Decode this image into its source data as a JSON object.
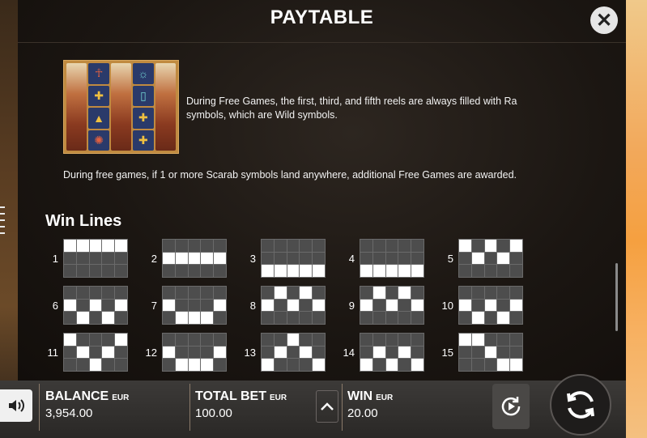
{
  "title": "PAYTABLE",
  "close_icon": "close-icon",
  "free_games_text_1": "During Free Games, the first, third, and fifth reels are always filled with Ra symbols, which are Wild symbols.",
  "free_games_text_2": "During free games, if 1 or more Scarab symbols land anywhere, additional Free Games are awarded.",
  "win_lines_title": "Win Lines",
  "win_lines": [
    {
      "number": "1",
      "pattern": [
        [
          1,
          1,
          1,
          1,
          1
        ],
        [
          0,
          0,
          0,
          0,
          0
        ],
        [
          0,
          0,
          0,
          0,
          0
        ]
      ]
    },
    {
      "number": "2",
      "pattern": [
        [
          0,
          0,
          0,
          0,
          0
        ],
        [
          1,
          1,
          1,
          1,
          1
        ],
        [
          0,
          0,
          0,
          0,
          0
        ]
      ]
    },
    {
      "number": "3",
      "pattern": [
        [
          0,
          0,
          0,
          0,
          0
        ],
        [
          0,
          0,
          0,
          0,
          0
        ],
        [
          1,
          1,
          1,
          1,
          1
        ]
      ]
    },
    {
      "number": "4",
      "pattern": [
        [
          0,
          0,
          0,
          0,
          0
        ],
        [
          0,
          0,
          0,
          0,
          0
        ],
        [
          1,
          1,
          1,
          1,
          1
        ]
      ]
    },
    {
      "number": "5",
      "pattern": [
        [
          1,
          0,
          1,
          0,
          1
        ],
        [
          0,
          1,
          0,
          1,
          0
        ],
        [
          0,
          0,
          0,
          0,
          0
        ]
      ]
    },
    {
      "number": "6",
      "pattern": [
        [
          0,
          0,
          0,
          0,
          0
        ],
        [
          1,
          0,
          1,
          0,
          1
        ],
        [
          0,
          1,
          0,
          1,
          0
        ]
      ]
    },
    {
      "number": "7",
      "pattern": [
        [
          0,
          0,
          0,
          0,
          0
        ],
        [
          1,
          0,
          0,
          0,
          1
        ],
        [
          0,
          1,
          1,
          1,
          0
        ]
      ]
    },
    {
      "number": "8",
      "pattern": [
        [
          0,
          1,
          0,
          1,
          0
        ],
        [
          1,
          0,
          1,
          0,
          1
        ],
        [
          0,
          0,
          0,
          0,
          0
        ]
      ]
    },
    {
      "number": "9",
      "pattern": [
        [
          0,
          1,
          0,
          1,
          0
        ],
        [
          1,
          0,
          1,
          0,
          1
        ],
        [
          0,
          0,
          0,
          0,
          0
        ]
      ]
    },
    {
      "number": "10",
      "pattern": [
        [
          0,
          0,
          0,
          0,
          0
        ],
        [
          1,
          0,
          1,
          0,
          1
        ],
        [
          0,
          1,
          0,
          1,
          0
        ]
      ]
    },
    {
      "number": "11",
      "pattern": [
        [
          1,
          0,
          0,
          0,
          1
        ],
        [
          0,
          1,
          0,
          1,
          0
        ],
        [
          0,
          0,
          1,
          0,
          0
        ]
      ]
    },
    {
      "number": "12",
      "pattern": [
        [
          0,
          0,
          0,
          0,
          0
        ],
        [
          1,
          0,
          0,
          0,
          1
        ],
        [
          0,
          1,
          1,
          1,
          0
        ]
      ]
    },
    {
      "number": "13",
      "pattern": [
        [
          0,
          0,
          1,
          0,
          0
        ],
        [
          0,
          1,
          0,
          1,
          0
        ],
        [
          1,
          0,
          0,
          0,
          1
        ]
      ]
    },
    {
      "number": "14",
      "pattern": [
        [
          0,
          0,
          0,
          0,
          0
        ],
        [
          0,
          1,
          0,
          1,
          0
        ],
        [
          1,
          0,
          1,
          0,
          1
        ]
      ]
    },
    {
      "number": "15",
      "pattern": [
        [
          1,
          1,
          0,
          0,
          0
        ],
        [
          0,
          0,
          1,
          0,
          0
        ],
        [
          0,
          0,
          0,
          1,
          1
        ]
      ]
    }
  ],
  "bottom_bar": {
    "balance_label": "BALANCE",
    "balance_currency": "EUR",
    "balance_value": "3,954.00",
    "total_bet_label": "TOTAL BET",
    "total_bet_currency": "EUR",
    "total_bet_value": "100.00",
    "win_label": "WIN",
    "win_currency": "EUR",
    "win_value": "20.00",
    "sound_icon": "speaker-icon",
    "bet_up_icon": "chevron-up-icon",
    "autoplay_icon": "autoplay-icon",
    "spin_icon": "spin-icon"
  }
}
